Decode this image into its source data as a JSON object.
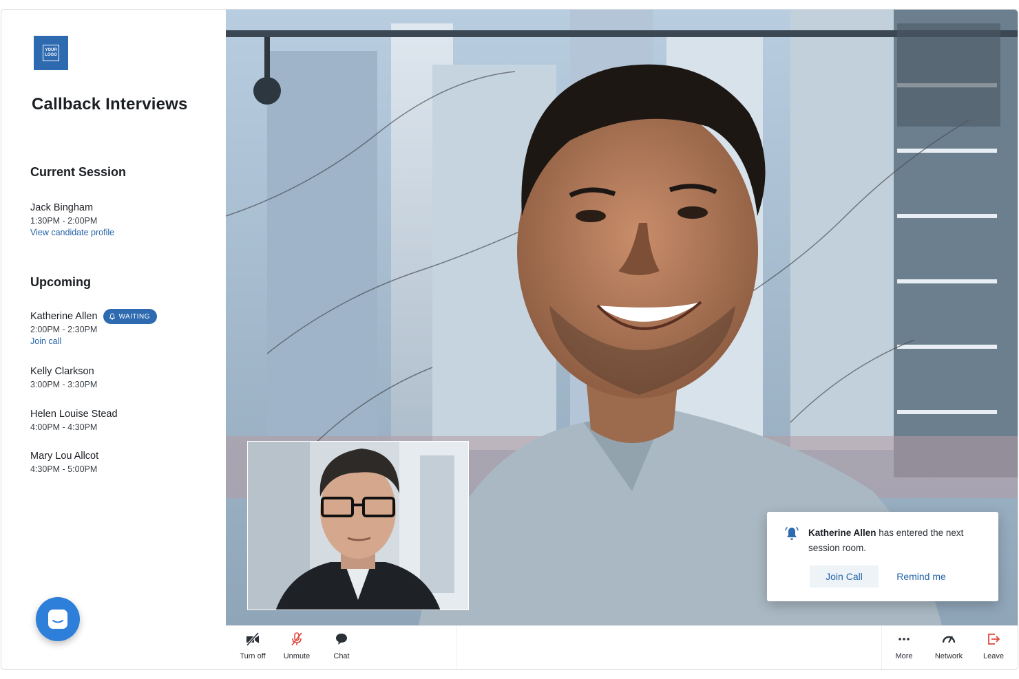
{
  "logo": {
    "line1": "YOUR",
    "line2": "LOGO"
  },
  "app_title": "Callback Interviews",
  "current_session": {
    "title": "Current Session",
    "name": "Jack Bingham",
    "time": "1:30PM - 2:00PM",
    "link": "View candidate profile"
  },
  "upcoming": {
    "title": "Upcoming",
    "items": [
      {
        "name": "Katherine Allen",
        "badge": "WAITING",
        "time": "2:00PM - 2:30PM",
        "link": "Join call"
      },
      {
        "name": "Kelly Clarkson",
        "time": "3:00PM - 3:30PM"
      },
      {
        "name": "Helen Louise Stead",
        "time": "4:00PM - 4:30PM"
      },
      {
        "name": "Mary Lou Allcot",
        "time": "4:30PM - 5:00PM"
      }
    ]
  },
  "notification": {
    "name": "Katherine Allen",
    "message": " has entered the next session room.",
    "join_label": "Join Call",
    "remind_label": "Remind me"
  },
  "toolbar": {
    "left": [
      {
        "label": "Turn off",
        "icon": "video-off-icon"
      },
      {
        "label": "Unmute",
        "icon": "mic-off-icon"
      },
      {
        "label": "Chat",
        "icon": "chat-bubble-icon"
      }
    ],
    "right": [
      {
        "label": "More",
        "icon": "more-dots-icon"
      },
      {
        "label": "Network",
        "icon": "network-gauge-icon"
      },
      {
        "label": "Leave",
        "icon": "leave-icon"
      }
    ]
  },
  "colors": {
    "brand": "#2d6ab0",
    "link": "#2463a8",
    "leave": "#e0473c",
    "mute": "#e0473c"
  }
}
